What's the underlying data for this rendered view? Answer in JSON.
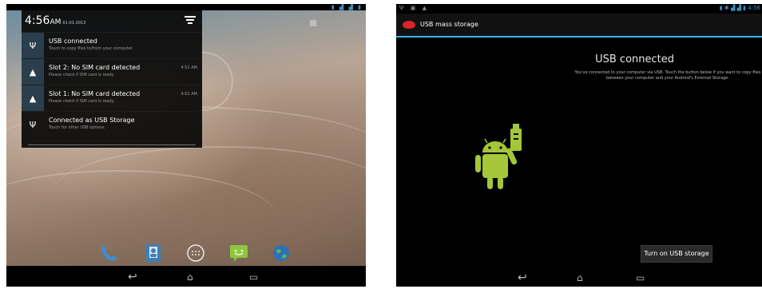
{
  "left_screen": {
    "shade": {
      "time": "4:56",
      "ampm": "AM",
      "date": "01-01-2013",
      "notifications": [
        {
          "icon": "usb-icon",
          "title": "USB connected",
          "subtitle": "Touch to copy files to/from your computer.",
          "time": ""
        },
        {
          "icon": "warning-icon",
          "title": "Slot 2: No SIM card detected",
          "subtitle": "Please check if SIM card is ready",
          "time": "4:52 AM"
        },
        {
          "icon": "warning-icon",
          "title": "Slot 1: No SIM card detected",
          "subtitle": "Please check if SIM card is ready",
          "time": "4:52 AM"
        },
        {
          "icon": "usb-icon",
          "title": "Connected as USB Storage",
          "subtitle": "Touch for other USB options.",
          "time": ""
        }
      ]
    },
    "dock": [
      "phone-icon",
      "contacts-icon",
      "app-drawer-icon",
      "messaging-icon",
      "browser-icon"
    ],
    "nav": [
      "back-icon",
      "home-icon",
      "recents-icon"
    ]
  },
  "right_screen": {
    "app_title": "USB mass storage",
    "heading": "USB connected",
    "description": "You've connected to your computer via USB. Touch the button below if you want to copy files between your computer and your Android's External Storage.",
    "button_label": "Turn on USB storage",
    "status_time": "4:56",
    "nav": [
      "back-icon",
      "home-icon",
      "recents-icon"
    ]
  },
  "colors": {
    "accent": "#33b5e5",
    "android_green": "#a4c639",
    "notif_icon_bg": "#2a3e4d"
  }
}
